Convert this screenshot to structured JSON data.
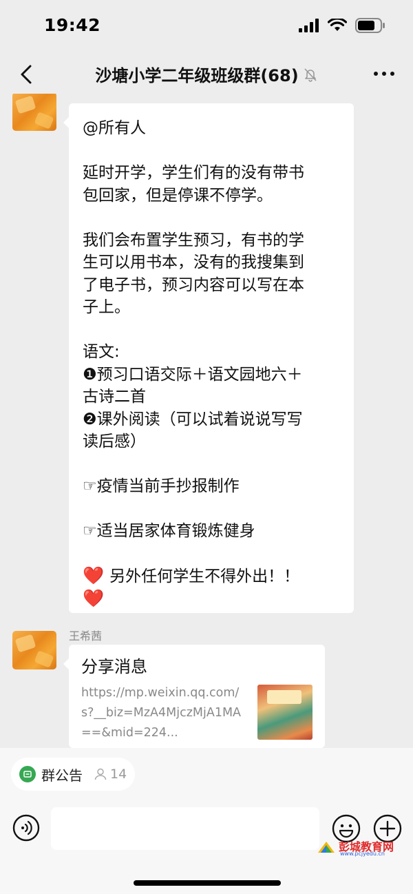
{
  "status_bar": {
    "time": "19:42"
  },
  "header": {
    "title": "沙塘小学二年级班级群(68)"
  },
  "messages": [
    {
      "sender": "",
      "lines": [
        "@所有人",
        "",
        "延时开学，学生们有的没有带书",
        "包回家，但是停课不停学。",
        "",
        "我们会布置学生预习，有书的学",
        "生可以用书本，没有的我搜集到",
        "了电子书，预习内容可以写在本",
        "子上。",
        "",
        "语文:",
        "❶预习口语交际＋语文园地六＋",
        "古诗二首",
        "❷课外阅读（可以试着说说写写",
        "读后感）",
        "",
        "☞疫情当前手抄报制作",
        "",
        "☞适当居家体育锻炼健身",
        ""
      ],
      "final_text": "另外任何学生不得外出！！",
      "heart_glyph": "❤️"
    },
    {
      "sender": "王希茜",
      "share": {
        "title": "分享消息",
        "link": "https://mp.weixin.qq.com/s?__biz=MzA4MjczMjA1MA==&mid=224..."
      }
    }
  ],
  "notice_bar": {
    "label": "群公告",
    "member_count": "14"
  },
  "input": {
    "placeholder": ""
  },
  "watermark": {
    "text": "彭城教育网",
    "url": "www.pcjyedu.cn"
  },
  "colors": {
    "background": "#ededed",
    "bubble": "#ffffff",
    "notice_green": "#36a853",
    "heart_red": "#d9272e"
  },
  "icons": [
    "back-icon",
    "mute-icon",
    "more-icon",
    "voice-icon",
    "emoji-icon",
    "plus-icon",
    "announcement-icon",
    "member-icon",
    "signal-icon",
    "wifi-icon",
    "battery-icon"
  ]
}
